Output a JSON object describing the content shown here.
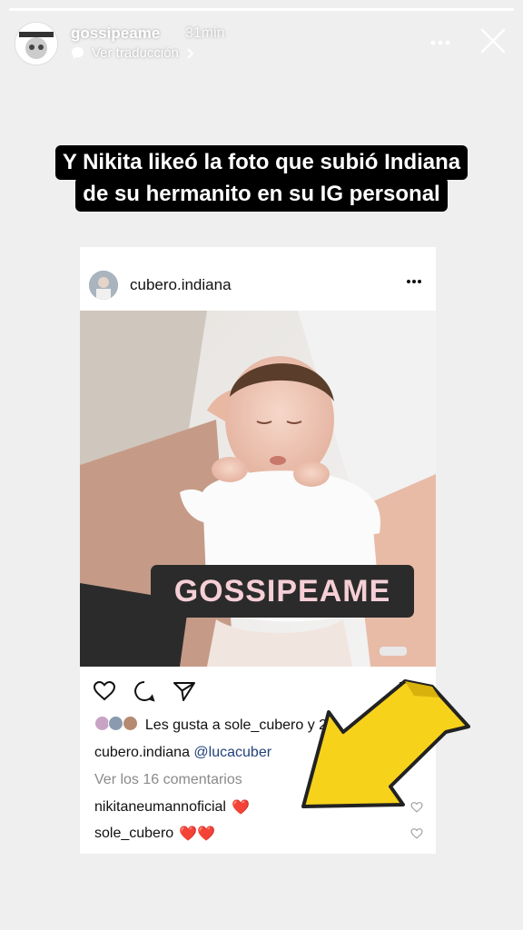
{
  "story": {
    "username": "gossipeame",
    "time": "31min",
    "translate": "Ver traducción",
    "avatar_text": "GOSSIPEAME",
    "progress": 1.0
  },
  "caption": {
    "line1": "Y Nikita likeó la foto que subió Indiana",
    "line2": "de su hermanito en su IG personal"
  },
  "post": {
    "username": "cubero.indiana",
    "stamp": "GOSSIPEAME",
    "likes_text": "Les gusta a sole_cubero y 20",
    "caption_user": "cubero.indiana",
    "caption_mention": "@lucacuber",
    "comments_link": "Ver los 16 comentarios",
    "comments": [
      {
        "user": "nikitaneumannoficial",
        "emoji": "❤️"
      },
      {
        "user": "sole_cubero",
        "emoji": "❤️❤️"
      }
    ]
  },
  "icons": {
    "more": "more-icon",
    "close": "close-icon",
    "heart": "heart-icon",
    "comment": "comment-icon",
    "share": "share-icon",
    "bookmark": "bookmark-icon",
    "arrow": "yellow-arrow"
  },
  "colors": {
    "caption_bg": "#000000",
    "stamp_bg": "#2b2b2b",
    "stamp_text": "#f6cfd6",
    "arrow": "#f7d21b",
    "mention": "#22427a"
  }
}
